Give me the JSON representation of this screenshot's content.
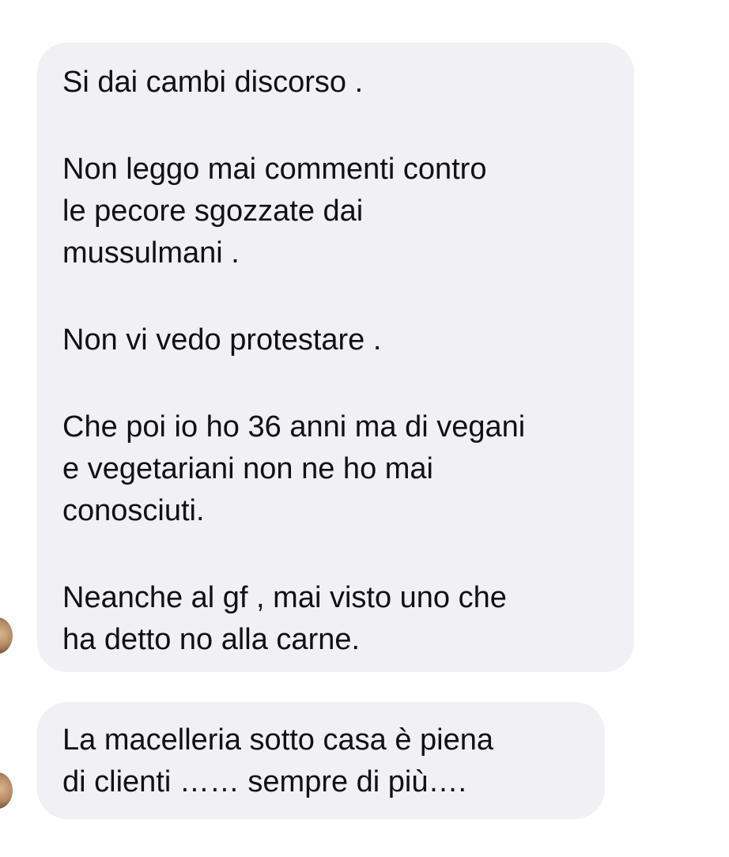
{
  "messages": [
    {
      "lines": [
        "Si dai cambi discorso .",
        "",
        "Non leggo mai commenti contro",
        "le pecore sgozzate dai",
        "mussulmani .",
        "",
        "Non vi vedo protestare .",
        "",
        "Che poi io ho 36 anni ma di vegani",
        "e vegetariani non ne ho mai",
        "conosciuti.",
        "",
        "Neanche al gf , mai visto uno che",
        "ha detto no alla carne."
      ]
    },
    {
      "lines": [
        "La macelleria sotto casa è piena",
        "di clienti …… sempre di più…."
      ]
    }
  ],
  "colors": {
    "bubble_background": "#f0f0f5",
    "text": "#111111",
    "page_background": "#ffffff"
  }
}
